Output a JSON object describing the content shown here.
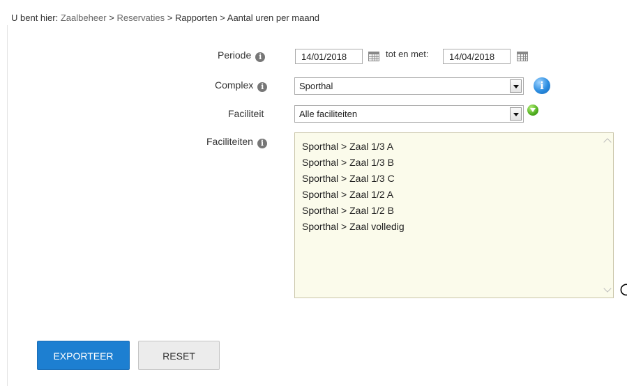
{
  "breadcrumb": {
    "prefix": "U bent hier:",
    "items": [
      "Zaalbeheer",
      "Reservaties",
      "Rapporten",
      "Aantal uren per maand"
    ],
    "separator": ">"
  },
  "form": {
    "periode": {
      "label": "Periode",
      "from": "14/01/2018",
      "to_label": "tot en met:",
      "to": "14/04/2018"
    },
    "complex": {
      "label": "Complex",
      "value": "Sporthal"
    },
    "faciliteit": {
      "label": "Faciliteit",
      "value": "Alle faciliteiten"
    },
    "faciliteiten": {
      "label": "Faciliteiten",
      "items": [
        "Sporthal > Zaal 1/3 A",
        "Sporthal > Zaal 1/3 B",
        "Sporthal > Zaal 1/3 C",
        "Sporthal > Zaal 1/2 A",
        "Sporthal > Zaal 1/2 B",
        "Sporthal > Zaal volledig"
      ]
    }
  },
  "buttons": {
    "export": "EXPORTEER",
    "reset": "RESET"
  },
  "icons": {
    "info": "info-icon",
    "calendar": "calendar-icon",
    "blue_info": "info-circle-icon",
    "add": "add-down-icon"
  },
  "colors": {
    "primary": "#1d7fd1",
    "listbox_bg": "#fbfbeb"
  }
}
